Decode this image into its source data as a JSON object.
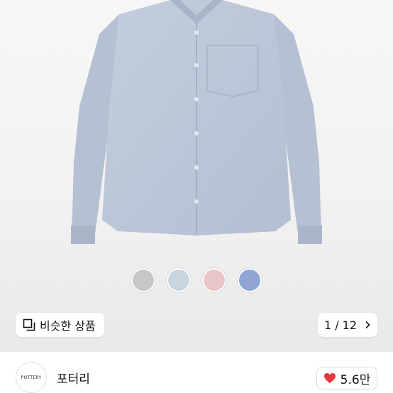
{
  "product": {
    "image_alt": "light blue oxford shirt"
  },
  "swatches": [
    {
      "name": "gray",
      "color": "#c5c7c9"
    },
    {
      "name": "light-blue",
      "color": "#c6d5e0"
    },
    {
      "name": "pink",
      "color": "#e9c6c8"
    },
    {
      "name": "blue",
      "color": "#8fa6d4"
    }
  ],
  "similar_button": {
    "label": "비슷한 상품",
    "icon": "similar-items-icon"
  },
  "pager": {
    "text": "1 / 12",
    "icon": "chevron-right-icon"
  },
  "seller": {
    "logo_text": "POTTERY",
    "name": "포터리"
  },
  "like": {
    "count": "5.6만",
    "icon": "heart-icon",
    "color": "#e5393e"
  }
}
